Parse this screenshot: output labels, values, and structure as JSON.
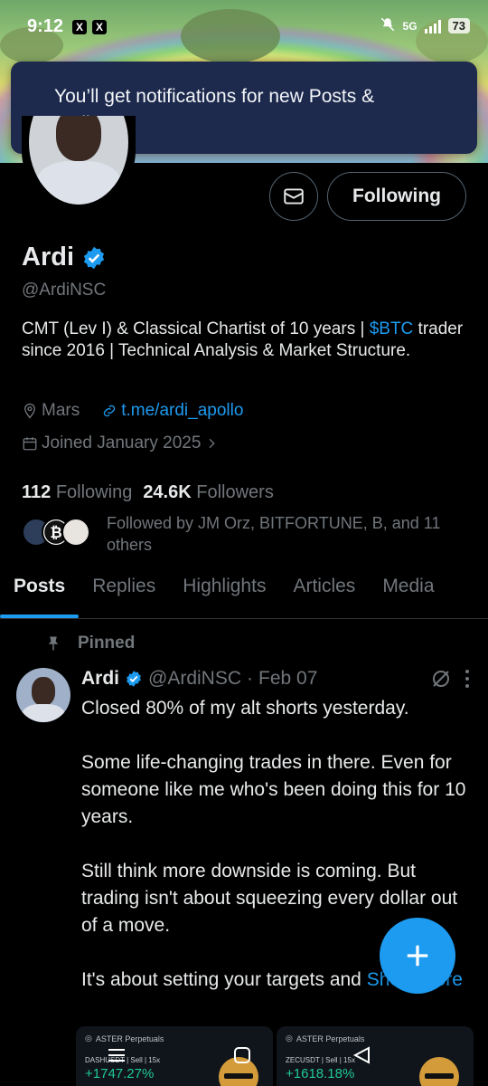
{
  "status_bar": {
    "time": "9:12",
    "network": "5G",
    "battery": "73"
  },
  "toast": {
    "message": "You’ll get notifications for new Posts & replies."
  },
  "profile": {
    "name": "Ardi",
    "handle": "@ArdiNSC",
    "bio_part1": "CMT (Lev I) & Classical Chartist of 10 years | ",
    "bio_cashtag": "$BTC",
    "bio_part2": " trader since 2016 | Technical Analysis & Market Structure.",
    "location": "Mars",
    "website": "t.me/ardi_apollo",
    "joined": "Joined January 2025",
    "following_count": "112",
    "following_label": "Following",
    "followers_count": "24.6K",
    "followers_label": "Followers",
    "followed_by": "Followed by JM Orz, BITFORTUNE, B, and 11 others"
  },
  "actions": {
    "following_button": "Following"
  },
  "tabs": [
    {
      "label": "Posts",
      "active": true
    },
    {
      "label": "Replies",
      "active": false
    },
    {
      "label": "Highlights",
      "active": false
    },
    {
      "label": "Articles",
      "active": false
    },
    {
      "label": "Media",
      "active": false
    }
  ],
  "pinned_post": {
    "pinned_label": "Pinned",
    "author": "Ardi",
    "handle": "@ArdiNSC",
    "date": "Feb 07",
    "paragraphs": [
      "Closed 80% of my alt shorts yesterday.",
      "Some life-changing trades in there. Even for someone like me who's been doing this for 10 years.",
      "Still think more downside is coming. But trading isn't about squeezing every dollar out of a move."
    ],
    "last_line": "It's about setting your targets and",
    "show_more": "Show more",
    "media": [
      {
        "brand": "ASTER Perpetuals",
        "pair": "DASHUSDT",
        "side": "Sell",
        "leverage": "15x",
        "pnl": "+1747.27%"
      },
      {
        "brand": "ASTER Perpetuals",
        "pair": "ZECUSDT",
        "side": "Sell",
        "leverage": "15x",
        "pnl": "+1618.18%"
      }
    ]
  },
  "colors": {
    "accent": "#1d9bf0",
    "background": "#000000",
    "muted": "#71767b",
    "toast_bg": "#1d2a4d",
    "profit": "#20c997"
  }
}
